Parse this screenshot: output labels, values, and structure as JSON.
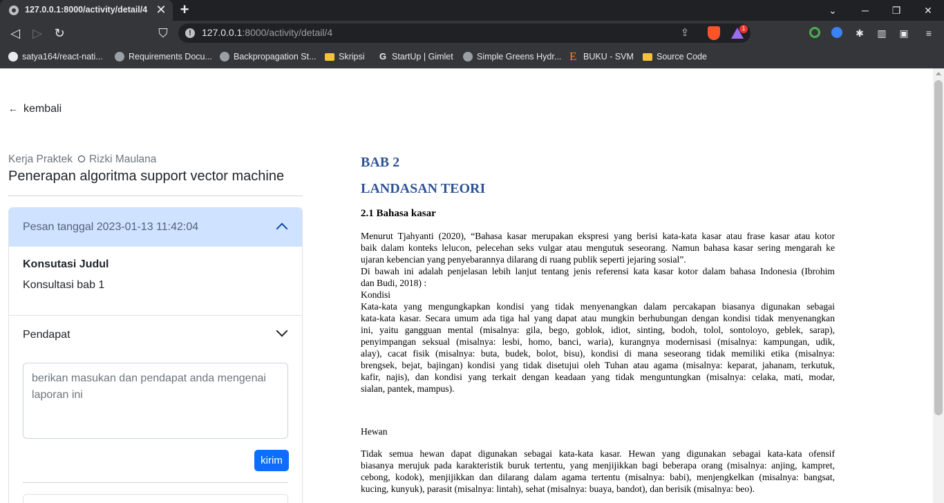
{
  "browser": {
    "tab_title": "127.0.0.1:8000/activity/detail/4",
    "tab_close": "✕",
    "new_tab": "+",
    "url_host": "127.0.0.1",
    "url_rest": ":8000/activity/detail/4",
    "vpn_badge": "1",
    "bookmarks": [
      {
        "label": "satya164/react-nati...",
        "icon": "github-icon"
      },
      {
        "label": "Requirements Docu...",
        "icon": "globe-icon"
      },
      {
        "label": "Backpropagation St...",
        "icon": "globe-icon"
      },
      {
        "label": "Skripsi",
        "icon": "folder-icon"
      },
      {
        "label": "StartUp | Gimlet",
        "icon": "gimlet-icon"
      },
      {
        "label": "Simple Greens Hydr...",
        "icon": "globe-icon"
      },
      {
        "label": "BUKU - SVM",
        "icon": "ebook-icon"
      },
      {
        "label": "Source Code",
        "icon": "folder-icon"
      }
    ]
  },
  "page": {
    "back_label": "kembali",
    "category": "Kerja Praktek",
    "author": "Rizki Maulana",
    "title": "Penerapan algoritma support vector machine",
    "accordion": {
      "header": "Pesan tanggal 2023-01-13 11:42:04",
      "subject_heading": "Konsutasi Judul",
      "subject_value": "Konsultasi bab 1",
      "opinion_heading": "Pendapat",
      "textarea_placeholder": "berikan masukan dan pendapat anda mengenai laporan ini",
      "submit_label": "kirim"
    }
  },
  "document": {
    "chapter": "BAB 2",
    "chapter_title": "LANDASAN TEORI",
    "section": "2.1 Bahasa kasar",
    "p1": [
      "Menurut Tjahyanti (2020), “Bahasa kasar merupakan ekspresi yang berisi kata-kata kasar atau frase kasar atau kotor",
      "baik dalam konteks lelucon, pelecehan seks vulgar atau mengutuk seseorang. Namun bahasa kasar sering mengarah ke",
      "ujaran kebencian yang penyebarannya dilarang di ruang publik seperti jejaring sosial”.",
      "Di bawah ini adalah penjelasan lebih lanjut tentang jenis referensi kata kasar kotor dalam bahasa Indonesia (Ibrohim",
      "dan Budi, 2018) :",
      "Kondisi"
    ],
    "p2": [
      "Kata-kata yang mengungkapkan kondisi yang tidak menyenangkan dalam percakapan biasanya digunakan sebagai",
      "kata-kata kasar. Secara umum ada tiga hal yang dapat atau mungkin berhubungan dengan kondisi tidak menyenangkan",
      "ini, yaitu gangguan mental (misalnya: gila, bego, goblok, idiot, sinting, bodoh, tolol, sontoloyo, geblek, sarap),",
      "penyimpangan seksual (misalnya: lesbi, homo, banci, waria), kurangnya modernisasi (misalnya: kampungan, udik,",
      "alay), cacat fisik (misalnya: buta, budek, bolot, bisu), kondisi di mana seseorang tidak memiliki etika (misalnya:",
      "brengsek, bejat, bajingan) kondisi yang tidak disetujui oleh Tuhan atau agama (misalnya: keparat, jahanam, terkutuk,",
      "kafir, najis), dan kondisi yang terkait dengan keadaan yang tidak menguntungkan (misalnya: celaka, mati, modar,",
      "sialan, pantek, mampus)."
    ],
    "hewan_heading": "Hewan",
    "p3": [
      "Tidak semua hewan dapat digunakan sebagai kata-kata kasar. Hewan yang digunakan sebagai kata-kata ofensif",
      "biasanya merujuk pada karakteristik buruk tertentu, yang menjijikkan bagi beberapa orang (misalnya: anjing, kampret,",
      "cebong, kodok), menjijikkan dan dilarang dalam agama tertentu (misalnya: babi), menjengkelkan (misalnya: bangsat,",
      "kucing, kunyuk), parasit (misalnya: lintah), sehat (misalnya: buaya, bandot), dan berisik (misalnya: beo)."
    ]
  }
}
